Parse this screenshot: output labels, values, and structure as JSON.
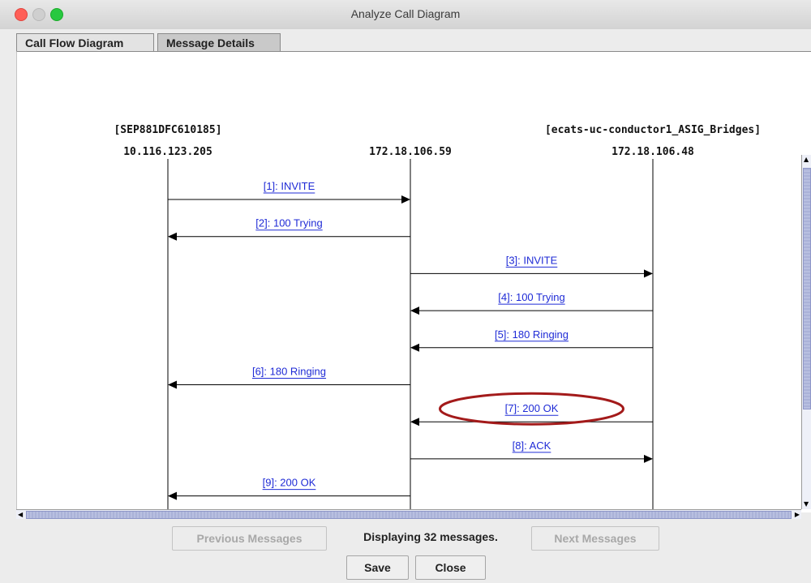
{
  "window": {
    "title": "Analyze Call Diagram"
  },
  "tabs": [
    {
      "label": "Call Flow Diagram"
    },
    {
      "label": "Message Details"
    }
  ],
  "nodes": [
    {
      "name": "[SEP881DFC610185]",
      "ip": "10.116.123.205"
    },
    {
      "name": "",
      "ip": "172.18.106.59"
    },
    {
      "name": "[ecats-uc-conductor1_ASIG_Bridges]",
      "ip": "172.18.106.48"
    }
  ],
  "messages": [
    {
      "label": "[1]: INVITE",
      "from": 0,
      "to": 1
    },
    {
      "label": "[2]: 100 Trying",
      "from": 1,
      "to": 0
    },
    {
      "label": "[3]: INVITE",
      "from": 1,
      "to": 2
    },
    {
      "label": "[4]: 100 Trying",
      "from": 2,
      "to": 1
    },
    {
      "label": "[5]: 180 Ringing",
      "from": 2,
      "to": 1
    },
    {
      "label": "[6]: 180 Ringing",
      "from": 1,
      "to": 0
    },
    {
      "label": "[7]: 200 OK",
      "from": 2,
      "to": 1
    },
    {
      "label": "[8]: ACK",
      "from": 1,
      "to": 2
    },
    {
      "label": "[9]: 200 OK",
      "from": 1,
      "to": 0
    }
  ],
  "highlight": {
    "message_index": 6,
    "color": "#a31a1a"
  },
  "colors": {
    "link": "#1f2bd6",
    "line": "#000000"
  },
  "footer": {
    "prev_label": "Previous Messages",
    "status": "Displaying 32 messages.",
    "next_label": "Next Messages",
    "save_label": "Save",
    "close_label": "Close"
  }
}
